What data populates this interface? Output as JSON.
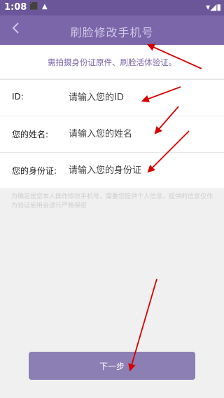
{
  "status_bar": {
    "time": "1:08"
  },
  "header": {
    "title": "刷脸修改手机号",
    "back_icon": "chevron-left-icon"
  },
  "notice": "需拍摄身份证原件、刷脸活体验证。",
  "form": {
    "rows": [
      {
        "label": "ID:",
        "placeholder": "请输入您的ID"
      },
      {
        "label": "您的姓名:",
        "placeholder": "请输入您的姓名"
      },
      {
        "label": "您的身份证:",
        "placeholder": "请输入您的身份证"
      }
    ]
  },
  "hint": "为确定是您本人操作修改手机号，需要您提供个人信息，提供的信息仅作为验证使用会进行严格保密",
  "next_button": "下一步",
  "colors": {
    "header": "#7a66a9",
    "status_bar": "#6a5698",
    "button": "#8c7fb4",
    "annotation_arrow": "#d60000"
  }
}
